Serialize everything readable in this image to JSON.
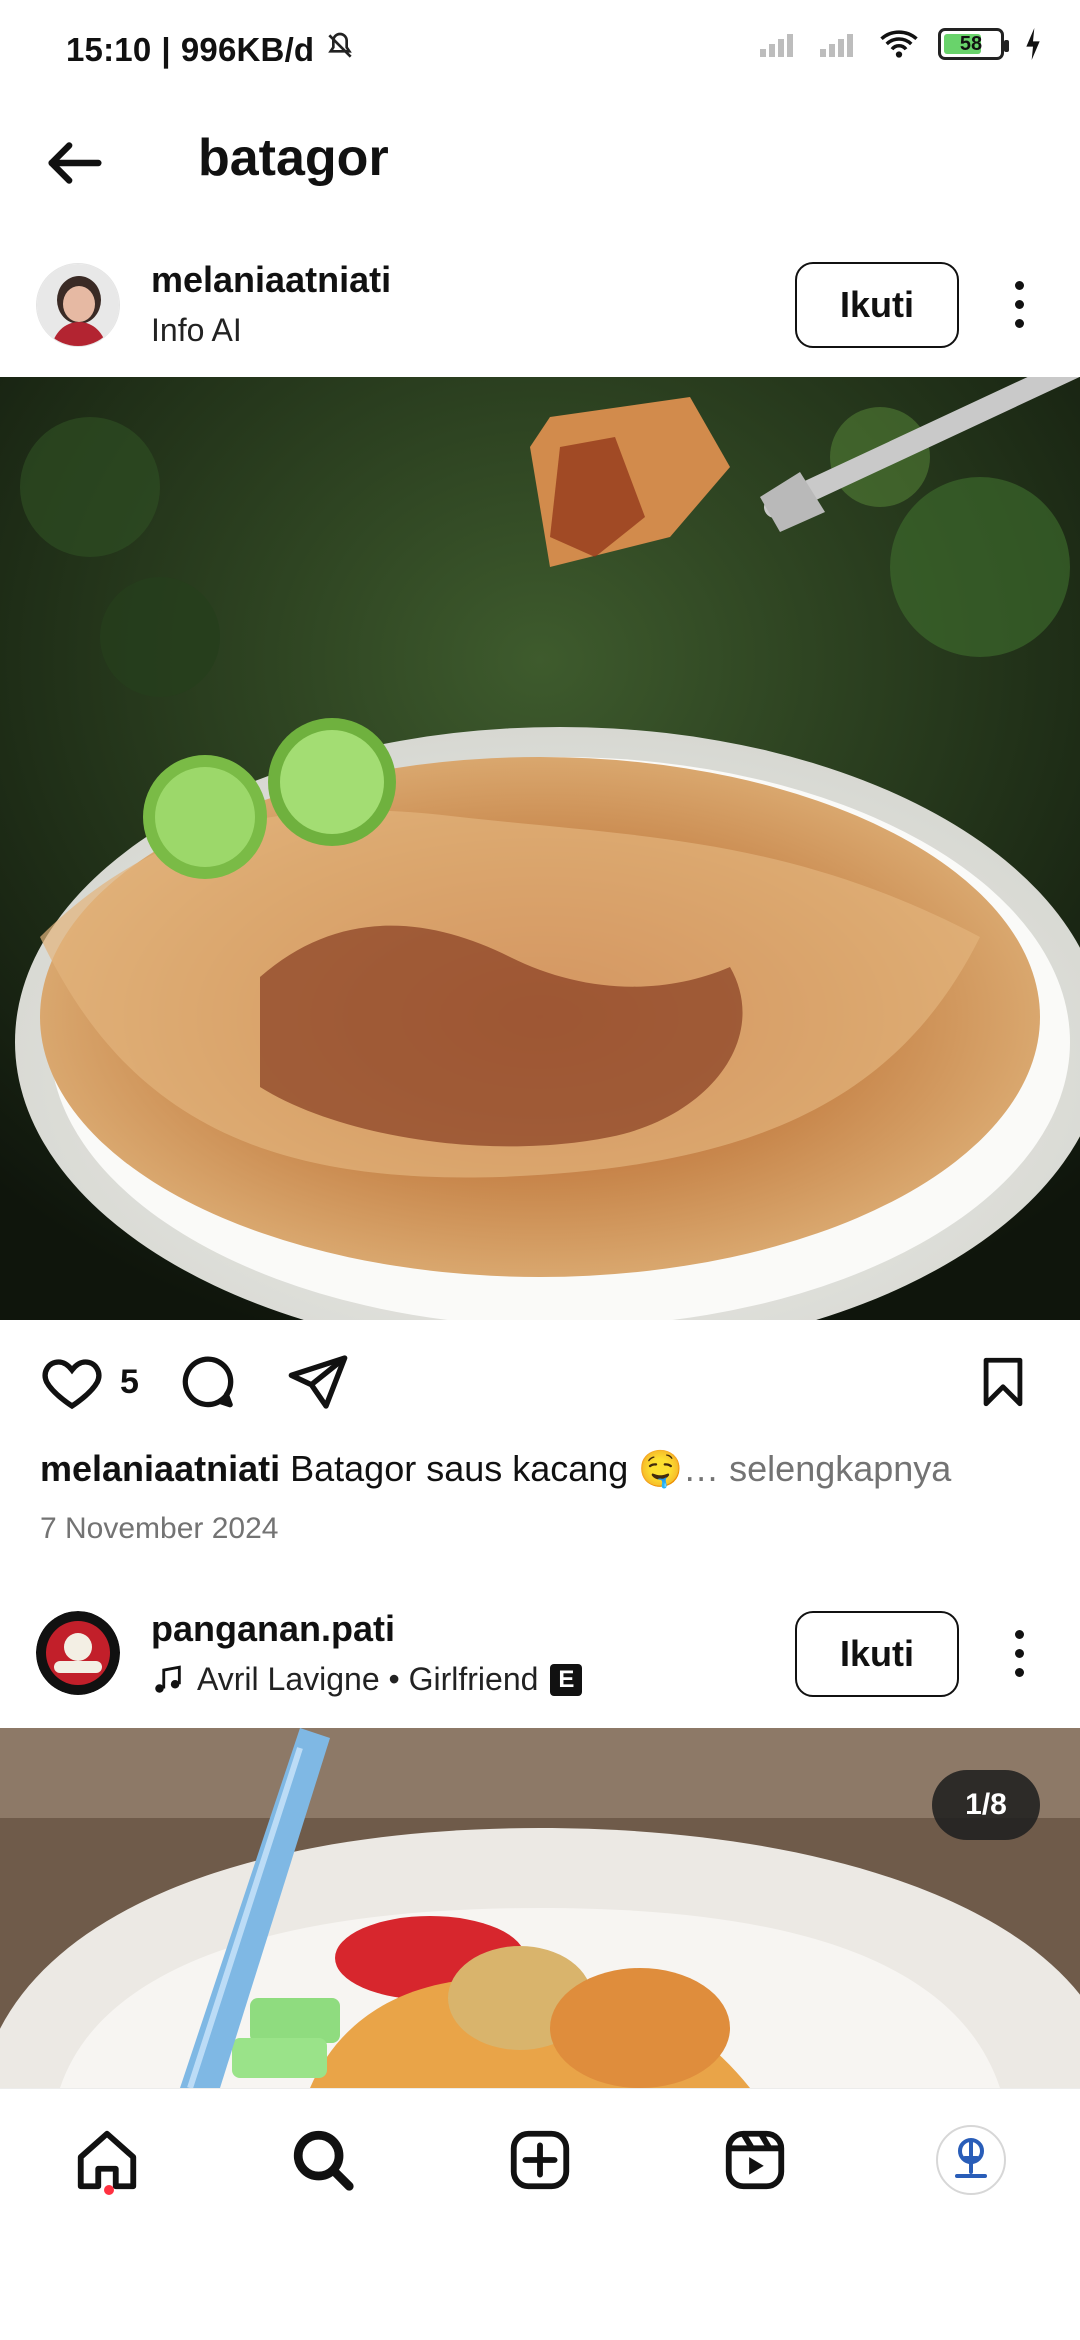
{
  "status_bar": {
    "time": "15:10",
    "speed": "996KB/d",
    "battery_level": "58"
  },
  "header": {
    "title": "batagor"
  },
  "posts": [
    {
      "username": "melaniaatniati",
      "subtitle": "Info AI",
      "follow_label": "Ikuti",
      "likes": "5",
      "caption_user": "melaniaatniati",
      "caption_text": "Batagor saus kacang 🤤",
      "caption_more": "… selengkapnya",
      "date": "7 November 2024"
    },
    {
      "username": "panganan.pati",
      "music": "Avril Lavigne • Girlfriend",
      "explicit_badge": "E",
      "follow_label": "Ikuti",
      "counter": "1/8"
    }
  ],
  "icons": {
    "back": "back-arrow-icon",
    "heart": "heart-icon",
    "comment": "comment-icon",
    "share": "send-icon",
    "bookmark": "bookmark-icon",
    "home": "home-icon",
    "search": "search-icon",
    "create": "plus-square-icon",
    "reels": "reels-icon",
    "profile": "profile-avatar"
  },
  "colors": {
    "accent": "#ff3040",
    "muted": "#737373"
  }
}
